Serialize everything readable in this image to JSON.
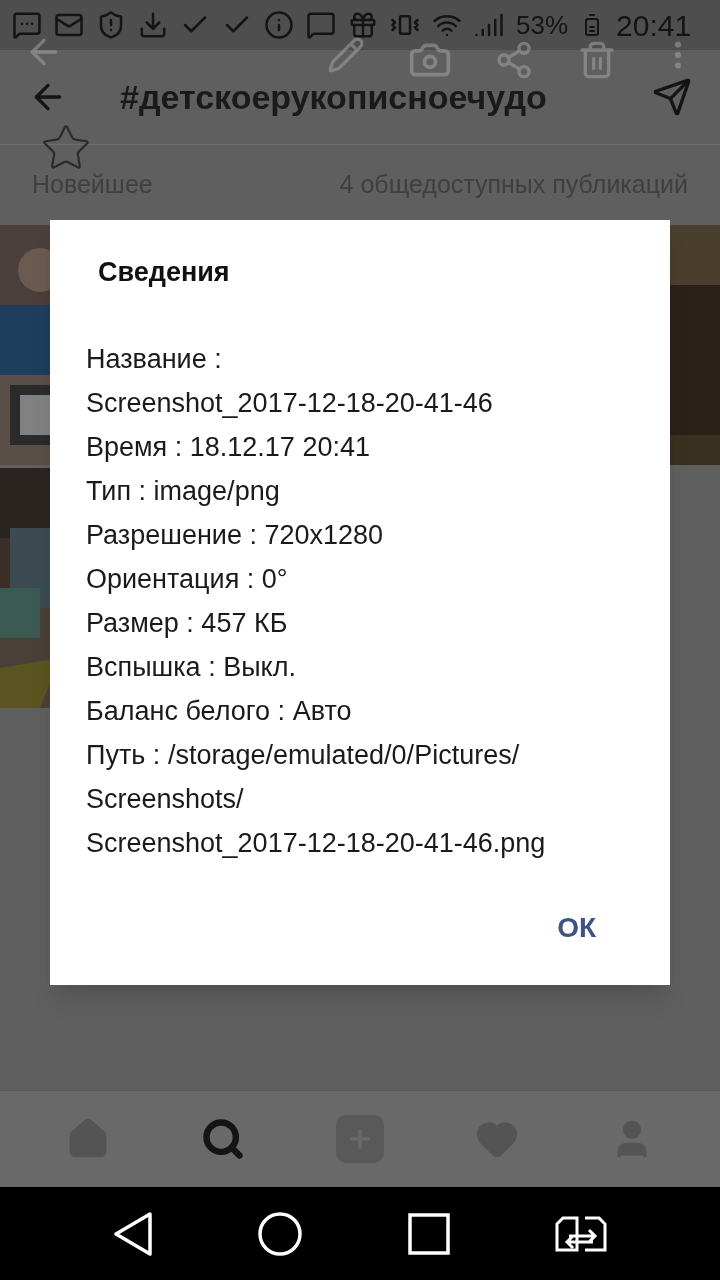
{
  "status_bar": {
    "battery": "53%",
    "time": "20:41"
  },
  "header": {
    "title": "#детскоерукописноечудо"
  },
  "subheader": {
    "sort": "Новейшее",
    "count": "4 общедоступных публикаций"
  },
  "dialog": {
    "title": "Сведения",
    "lines": [
      "Название : Screenshot_2017-12-18-20-41-46",
      "Время : 18.12.17 20:41",
      "Тип : image/png",
      "Разрешение : 720x1280",
      "Ориентация : 0°",
      "Размер : 457 КБ",
      "Вспышка : Выкл.",
      "Баланс белого : Авто",
      "Путь : /storage/emulated/0/Pictures/Screenshots/Screenshot_2017-12-18-20-41-46.png"
    ],
    "button": "ОК"
  },
  "bottom_nav": [
    {
      "kind": "home",
      "selected": false
    },
    {
      "kind": "search",
      "selected": true
    },
    {
      "kind": "add",
      "selected": false
    },
    {
      "kind": "heart",
      "selected": false
    },
    {
      "kind": "profile",
      "selected": false
    }
  ]
}
